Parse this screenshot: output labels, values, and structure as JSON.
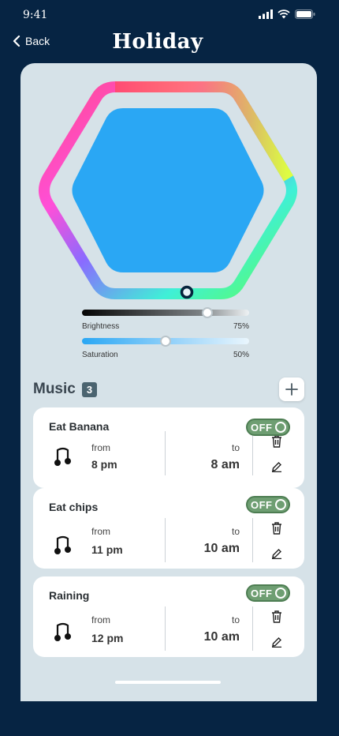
{
  "status": {
    "time": "9:41"
  },
  "header": {
    "back_label": "Back",
    "title": "Holiday"
  },
  "light": {
    "color": "#2aa7f4",
    "brightness": {
      "label": "Brightness",
      "value_label": "75%",
      "value": 0.75
    },
    "saturation": {
      "label": "Saturation",
      "value_label": "50%",
      "value": 0.5
    }
  },
  "music": {
    "title": "Music",
    "count": "3",
    "items": [
      {
        "name": "Eat Banana",
        "from_label": "from",
        "from": "8 pm",
        "to_label": "to",
        "to": "8 am",
        "toggle": "OFF"
      },
      {
        "name": "Eat chips",
        "from_label": "from",
        "from": "11 pm",
        "to_label": "to",
        "to": "10 am",
        "toggle": "OFF"
      },
      {
        "name": "Raining",
        "from_label": "from",
        "from": "12 pm",
        "to_label": "to",
        "to": "10 am",
        "toggle": "OFF"
      }
    ]
  },
  "icons": {
    "back": "chevron-left-icon",
    "add": "plus-icon",
    "delete": "trash-icon",
    "edit": "pencil-icon",
    "music": "music-note-icon"
  }
}
